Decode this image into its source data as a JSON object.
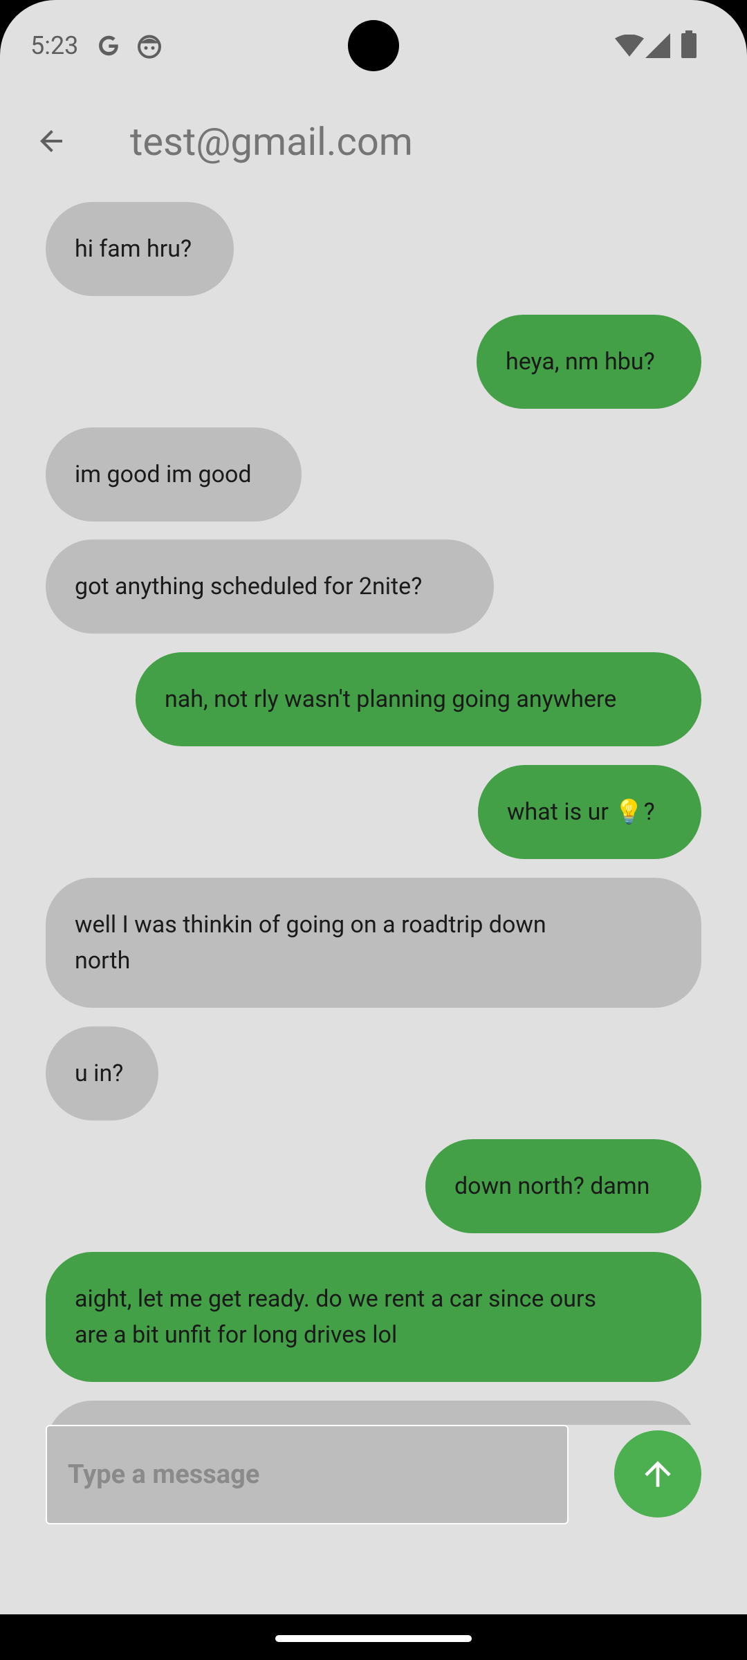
{
  "status_bar": {
    "time": "5:23",
    "icons": [
      "google-icon",
      "android-bot-icon",
      "wifi-icon",
      "signal-icon",
      "battery-icon"
    ]
  },
  "app_bar": {
    "title": "test@gmail.com",
    "back_icon": "arrow-back-icon"
  },
  "messages": [
    {
      "from": "other",
      "text": "hi fam hru?"
    },
    {
      "from": "me",
      "text": "heya, nm hbu?"
    },
    {
      "from": "other",
      "text": "im good im good"
    },
    {
      "from": "other",
      "text": "got anything scheduled for 2nite?"
    },
    {
      "from": "me",
      "text": "nah, not rly wasn't planning going anywhere"
    },
    {
      "from": "me",
      "text": "what is ur 💡?"
    },
    {
      "from": "other",
      "text": "well I was thinkin of going on a roadtrip down\nnorth"
    },
    {
      "from": "other",
      "text": "u in?"
    },
    {
      "from": "me",
      "text": "down north? damn"
    },
    {
      "from": "me",
      "text": "aight, let me get ready. do we rent a car since ours\nare a bit unfit for long drives lol"
    },
    {
      "from": "other",
      "text": ""
    }
  ],
  "composer": {
    "placeholder": "Type a message",
    "value": "",
    "send_icon": "arrow-up-icon"
  },
  "colors": {
    "background": "#e0e0e0",
    "received_bubble": "#bdbdbd",
    "sent_bubble": "#43a047",
    "send_button": "#4caf50"
  }
}
